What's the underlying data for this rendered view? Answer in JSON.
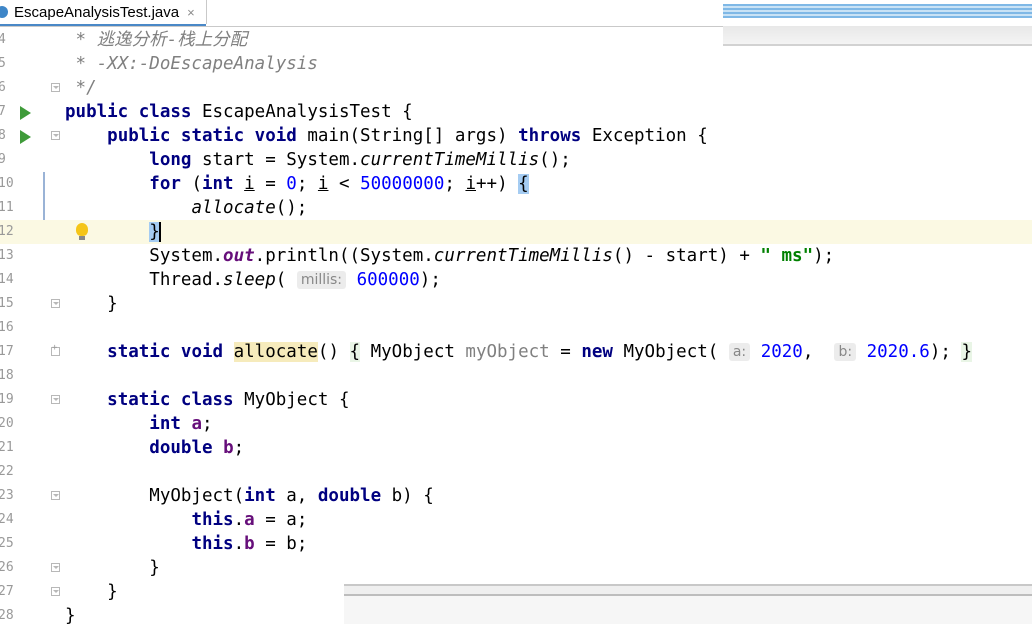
{
  "tab": {
    "filename": "EscapeAnalysisTest.java",
    "close_glyph": "×",
    "icon": "java-class-icon"
  },
  "lines": [
    {
      "n": "4",
      "text": " * 逃逸分析-栈上分配"
    },
    {
      "n": "5",
      "text": " * -XX:-DoEscapeAnalysis"
    },
    {
      "n": "6",
      "text": " */"
    },
    {
      "n": "7",
      "text": "public class EscapeAnalysisTest {"
    },
    {
      "n": "8",
      "text": "    public static void main(String[] args) throws Exception {"
    },
    {
      "n": "9",
      "text": "        long start = System.currentTimeMillis();"
    },
    {
      "n": "10",
      "text": "        for (int i = 0; i < 50000000; i++) {"
    },
    {
      "n": "11",
      "text": "            allocate();"
    },
    {
      "n": "12",
      "text": "        }"
    },
    {
      "n": "13",
      "text": "        System.out.println((System.currentTimeMillis() - start) + \" ms\");"
    },
    {
      "n": "14",
      "text": "        Thread.sleep( millis: 600000);"
    },
    {
      "n": "15",
      "text": "    }"
    },
    {
      "n": "16",
      "text": ""
    },
    {
      "n": "17",
      "text": "    static void allocate() { MyObject myObject = new MyObject( a: 2020,  b: 2020.6); }"
    },
    {
      "n": "18",
      "text": ""
    },
    {
      "n": "19",
      "text": "    static class MyObject {"
    },
    {
      "n": "20",
      "text": "        int a;"
    },
    {
      "n": "21",
      "text": "        double b;"
    },
    {
      "n": "22",
      "text": ""
    },
    {
      "n": "23",
      "text": "        MyObject(int a, double b) {"
    },
    {
      "n": "24",
      "text": "            this.a = a;"
    },
    {
      "n": "25",
      "text": "            this.b = b;"
    },
    {
      "n": "26",
      "text": "        }"
    },
    {
      "n": "27",
      "text": "    }"
    },
    {
      "n": "28",
      "text": "}"
    }
  ],
  "hints": {
    "millis": "millis:",
    "a": "a:",
    "b": "b:"
  },
  "tokens": {
    "ms": "\" ms\"",
    "n0": "0",
    "n50m": "50000000",
    "n600k": "600000",
    "n2020": "2020",
    "n20206": "2020.6"
  }
}
